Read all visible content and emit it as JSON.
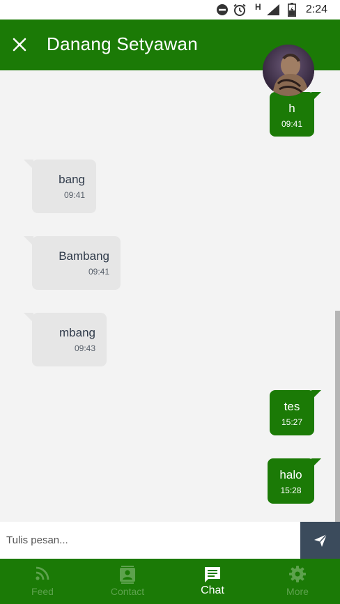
{
  "status_bar": {
    "time": "2:24",
    "network_label": "H",
    "icons": [
      "do-not-disturb-icon",
      "alarm-icon",
      "signal-icon",
      "battery-icon"
    ]
  },
  "app_bar": {
    "title": "Danang Setyawan",
    "close_icon": "close-icon"
  },
  "messages": [
    {
      "direction": "out",
      "text": "h",
      "time": "09:41"
    },
    {
      "direction": "in",
      "text": "bang",
      "time": "09:41"
    },
    {
      "direction": "in",
      "text": "Bambang",
      "time": "09:41"
    },
    {
      "direction": "in",
      "text": "mbang",
      "time": "09:43"
    },
    {
      "direction": "out",
      "text": "tes",
      "time": "15:27"
    },
    {
      "direction": "out",
      "text": "halo",
      "time": "15:28"
    }
  ],
  "composer": {
    "placeholder": "Tulis pesan...",
    "value": "",
    "send_icon": "send-icon"
  },
  "bottom_nav": {
    "items": [
      {
        "label": "Feed",
        "icon": "rss-feed-icon",
        "active": false
      },
      {
        "label": "Contact",
        "icon": "contact-card-icon",
        "active": false
      },
      {
        "label": "Chat",
        "icon": "chat-icon",
        "active": true
      },
      {
        "label": "More",
        "icon": "gear-icon",
        "active": false
      }
    ]
  },
  "colors": {
    "primary": "#1b7a06",
    "incoming_bubble": "#e6e6e6",
    "send_button": "#3b4b5c",
    "inactive_nav_label": "#5da24d"
  }
}
